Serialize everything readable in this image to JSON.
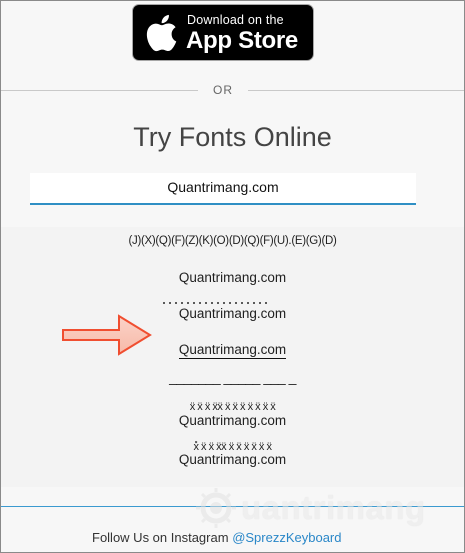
{
  "app_store": {
    "small_label": "Download on the",
    "big_label": "App Store"
  },
  "separator": {
    "label": "OR"
  },
  "main": {
    "title": "Try Fonts Online",
    "input_value": "Quantrimang.com"
  },
  "results": [
    {
      "text": "(J)(X)(Q)(F)(Z)(K)(O)(D)(Q)(F)(U).(E)(G)(D)"
    },
    {
      "text": "Quantrimang.com"
    },
    {
      "text": "Quantrimang.com"
    },
    {
      "text": "Quantrimang.com"
    },
    {
      "text": "_______ _____ ___ _"
    },
    {
      "text": "ẍ ẍ ẍ ẍẍ ẍ ẍ ẍ ẍ ẍ ẍ ẍ"
    },
    {
      "text": "Quantrimang.com"
    },
    {
      "text": "x̽ ẍ ẍ ẍẍ ẍ ẍ ẍ ẍ ẍ ẍ"
    },
    {
      "text": "Quantrimang.com"
    }
  ],
  "footer": {
    "prefix": "Follow Us on Instagram",
    "handle": "@SprezzKeyboard"
  },
  "watermark": {
    "text": "uantrimang"
  },
  "colors": {
    "accent": "#2f8fc4",
    "arrow": "#f04e30",
    "link": "#2a87c8"
  }
}
